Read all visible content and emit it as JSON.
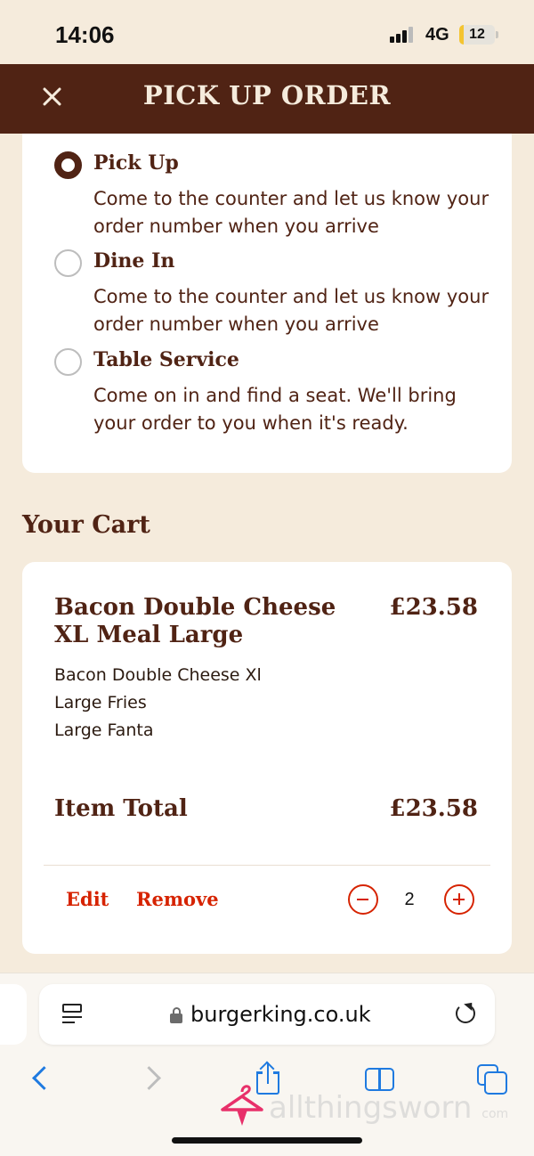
{
  "status_bar": {
    "time": "14:06",
    "network": "4G",
    "battery": "12",
    "battery_fraction": 0.12
  },
  "header": {
    "title": "PICK UP ORDER"
  },
  "service_options": [
    {
      "label": "Pick Up",
      "description": "Come to the counter and let us know your order number when you arrive",
      "selected": true
    },
    {
      "label": "Dine In",
      "description": "Come to the counter and let us know your order number when you arrive",
      "selected": false
    },
    {
      "label": "Table Service",
      "description": "Come on in and find a seat. We'll bring your order to you when it's ready.",
      "selected": false
    }
  ],
  "cart": {
    "title": "Your Cart",
    "item": {
      "name": "Bacon Double Cheese XL Meal Large",
      "price": "£23.58",
      "components": [
        "Bacon Double Cheese Xl",
        "Large Fries",
        "Large Fanta"
      ]
    },
    "total_label": "Item Total",
    "total_value": "£23.58",
    "edit_label": "Edit",
    "remove_label": "Remove",
    "quantity": "2"
  },
  "browser": {
    "url": "burgerking.co.uk"
  },
  "watermark": {
    "text": "allthingsworn",
    "sub": "com"
  },
  "icons": [
    "close-icon",
    "reader-mode-icon",
    "lock-icon",
    "reload-icon",
    "back-icon",
    "forward-icon",
    "share-icon",
    "bookmarks-icon",
    "tabs-icon",
    "hanger-logo-icon"
  ],
  "colors": {
    "brand_brown": "#502314",
    "cream": "#f5ebdc",
    "action_red": "#d62300",
    "ios_blue": "#1f7ae0"
  }
}
